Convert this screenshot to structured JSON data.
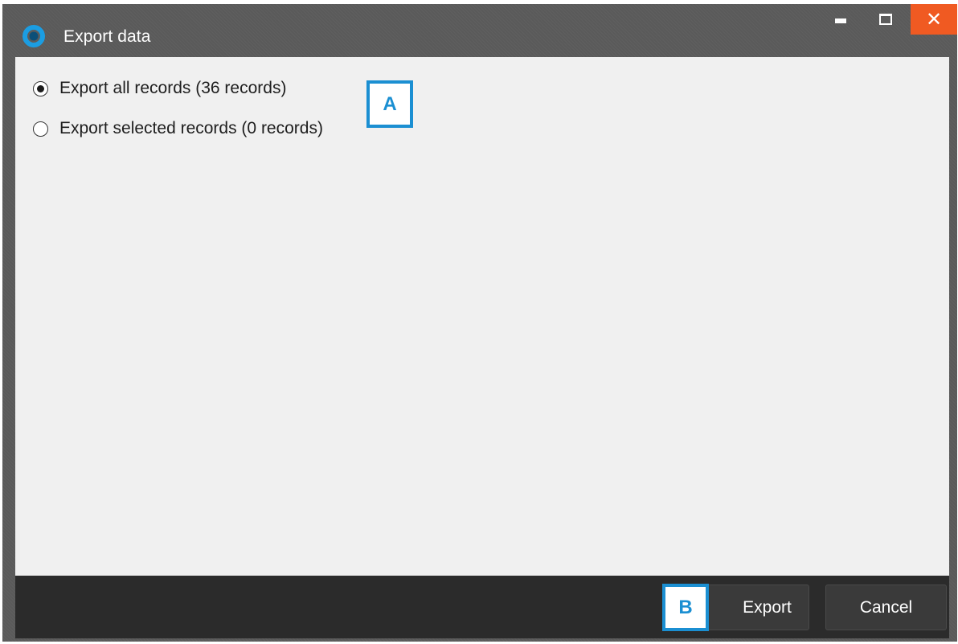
{
  "window": {
    "title": "Export data",
    "controls": {
      "minimize_icon": "minimize-icon",
      "maximize_icon": "maximize-icon",
      "close_icon": "close-icon",
      "close_glyph": "✕"
    }
  },
  "options": [
    {
      "label": "Export all records (36 records)",
      "selected": true
    },
    {
      "label": "Export selected records (0 records)",
      "selected": false
    }
  ],
  "callouts": {
    "a": "A",
    "b": "B"
  },
  "footer": {
    "export_label": "Export",
    "cancel_label": "Cancel"
  },
  "colors": {
    "accent": "#1b8fd2",
    "close": "#f05a22",
    "titlebar": "#5a5a5a",
    "content": "#f0f0f0",
    "footer": "#2b2b2b"
  }
}
